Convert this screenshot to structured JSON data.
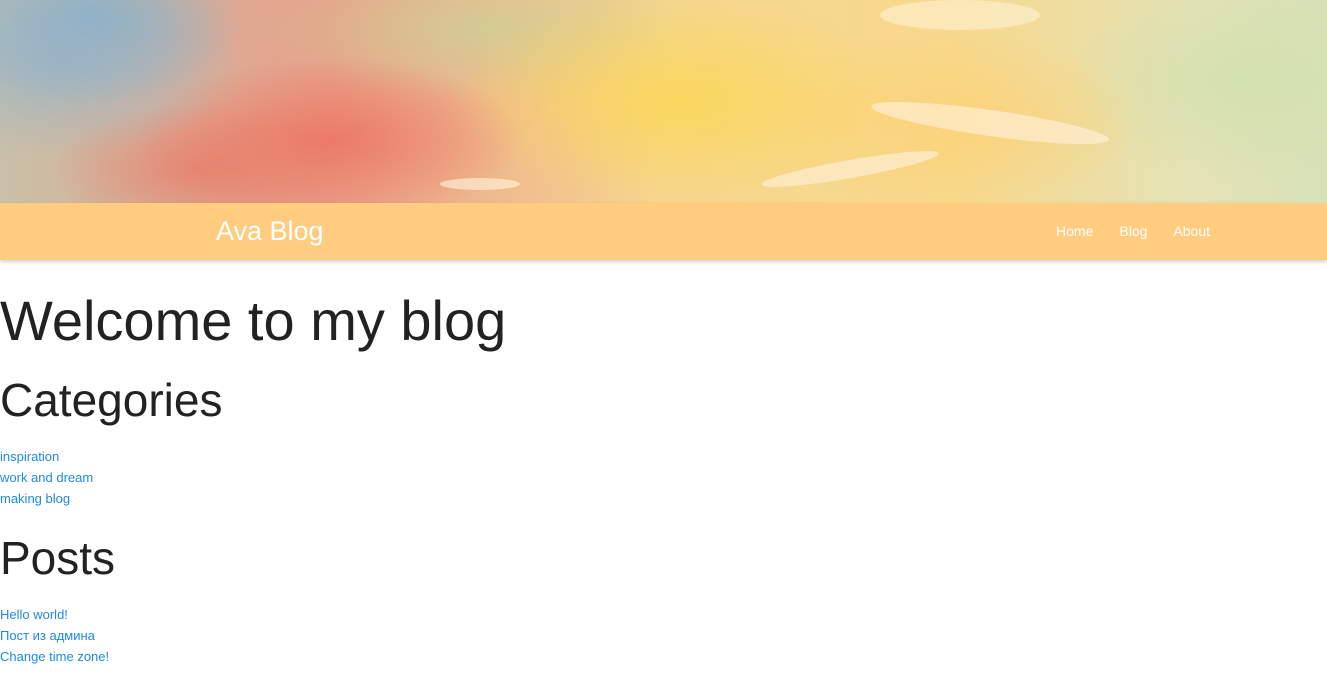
{
  "header": {
    "brand": "Ava Blog",
    "nav": [
      {
        "label": "Home"
      },
      {
        "label": "Blog"
      },
      {
        "label": "About"
      }
    ]
  },
  "main": {
    "title": "Welcome to my blog",
    "categories": {
      "heading": "Categories",
      "items": [
        "inspiration",
        "work and dream",
        "making blog"
      ]
    },
    "posts": {
      "heading": "Posts",
      "items": [
        "Hello world!",
        "Пост из админа",
        "Change time zone!"
      ]
    }
  },
  "colors": {
    "navbar": "#ffcc80",
    "link": "#1e88e5",
    "text": "#222222"
  }
}
